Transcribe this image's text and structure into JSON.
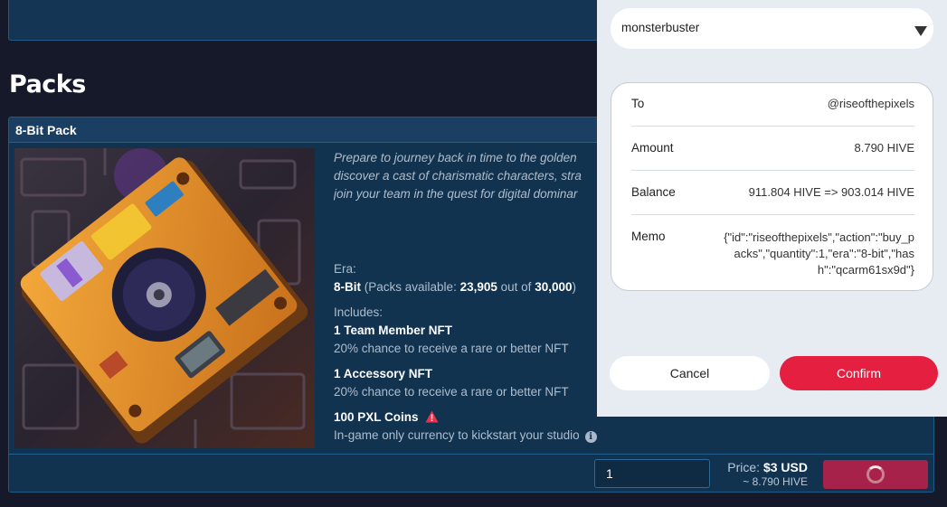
{
  "page": {
    "title": "Packs"
  },
  "pack": {
    "name": "8-Bit Pack",
    "description_lines": [
      "Prepare to journey back in time to the golden",
      "discover a cast of charismatic characters, stra",
      "join your team in the quest for digital dominar"
    ],
    "era_label": "Era:",
    "era_value": "8-Bit",
    "packs_available_prefix": "(Packs available:",
    "packs_available": "23,905",
    "packs_out_of": "out of",
    "packs_total": "30,000",
    "packs_suffix": ")",
    "includes_label": "Includes:",
    "includes": [
      {
        "title": "1 Team Member NFT",
        "detail": "20% chance to receive a rare or better NFT"
      },
      {
        "title": "1 Accessory NFT",
        "detail": "20% chance to receive a rare or better NFT"
      },
      {
        "title": "100 PXL Coins",
        "detail": "In-game only currency to kickstart your studio"
      }
    ],
    "quantity": "1",
    "price_label": "Price:",
    "price_usd": "$3 USD",
    "price_hive": "~ 8.790 HIVE",
    "icons": {
      "warning": "warning-icon",
      "info": "info-icon",
      "loading": "spinner-icon"
    }
  },
  "popup": {
    "account": "monsterbuster",
    "rows": {
      "to_label": "To",
      "to_value": "@riseofthepixels",
      "amount_label": "Amount",
      "amount_value": "8.790 HIVE",
      "balance_label": "Balance",
      "balance_value": "911.804 HIVE => 903.014 HIVE",
      "memo_label": "Memo",
      "memo_value": "{\"id\":\"riseofthepixels\",\"action\":\"buy_packs\",\"quantity\":1,\"era\":\"8-bit\",\"hash\":\"qcarm61sx9d\"}"
    },
    "cancel_label": "Cancel",
    "confirm_label": "Confirm"
  },
  "colors": {
    "accent": "#e51f3f",
    "card_bg": "#123350",
    "page_bg": "#16192a",
    "popup_bg": "#e7ecf3"
  }
}
